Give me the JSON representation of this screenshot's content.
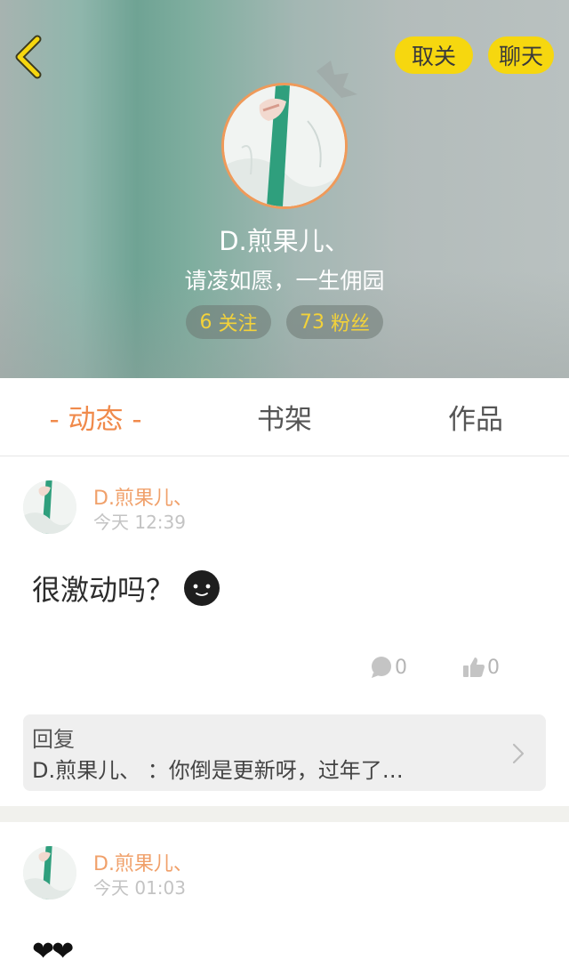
{
  "header": {
    "unfollow_label": "取关",
    "chat_label": "聊天",
    "username": "D.煎果儿、",
    "signature": "请凌如愿，一生佣园",
    "following": {
      "count": "6",
      "label": "关注"
    },
    "fans": {
      "count": "73",
      "label": "粉丝"
    }
  },
  "tabs": [
    {
      "label": "- 动态 -",
      "active": true
    },
    {
      "label": "书架",
      "active": false
    },
    {
      "label": "作品",
      "active": false
    }
  ],
  "posts": [
    {
      "author": "D.煎果儿、",
      "time": "今天 12:39",
      "content": "很激动吗？",
      "comments": "0",
      "likes": "0",
      "reply": {
        "label": "回复",
        "text": "D.煎果儿、 ：你倒是更新呀，过年了…"
      }
    },
    {
      "author": "D.煎果儿、",
      "time": "今天 01:03",
      "content": "❤❤"
    }
  ],
  "icons": {
    "back": "chevron-left-icon",
    "comment": "comment-bubble-icon",
    "like": "thumbs-up-icon",
    "reply_arrow": "chevron-right-icon",
    "emoji": "smiley-face-icon"
  },
  "colors": {
    "accent": "#f08a4b",
    "button_yellow": "#f6d70f",
    "stat_text": "#f3d23a",
    "author_name": "#f0a06a"
  }
}
